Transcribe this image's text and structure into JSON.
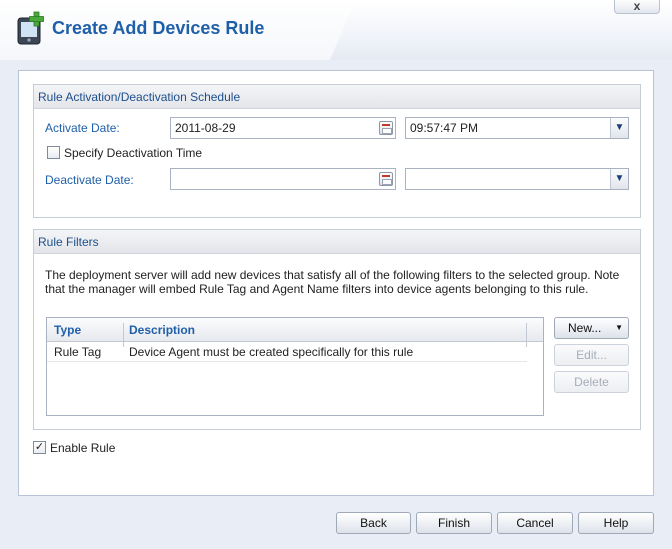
{
  "window": {
    "title": "Create Add Devices Rule",
    "close_label": "x"
  },
  "schedule": {
    "heading": "Rule Activation/Deactivation Schedule",
    "activate_label": "Activate Date:",
    "activate_date": "2011-08-29",
    "activate_time": "09:57:47 PM",
    "deactivation_checkbox_label": "Specify Deactivation Time",
    "deactivation_checked": false,
    "deactivate_label": "Deactivate Date:",
    "deactivate_date": "",
    "deactivate_time": ""
  },
  "filters": {
    "heading": "Rule Filters",
    "description": "The deployment server will add new devices that satisfy all of the following filters to the selected group. Note that the manager will embed Rule Tag and Agent Name filters into device agents belonging to this rule.",
    "columns": [
      "Type",
      "Description"
    ],
    "rows": [
      {
        "type": "Rule Tag",
        "description": "Device Agent must be created specifically for this rule"
      }
    ],
    "new_button": "New...",
    "edit_button": "Edit...",
    "delete_button": "Delete"
  },
  "enable_rule": {
    "label": "Enable Rule",
    "checked": true
  },
  "footer": {
    "back": "Back",
    "finish": "Finish",
    "cancel": "Cancel",
    "help": "Help"
  },
  "colors": {
    "title": "#1f5fa9",
    "label": "#1f5fa9",
    "section_head_text": "#1d4f8c",
    "background": "#e9eef6"
  },
  "icons": {
    "header": "add-device-icon",
    "close": "close-icon",
    "calendar": "calendar-icon",
    "dropdown": "chevron-down-icon"
  }
}
